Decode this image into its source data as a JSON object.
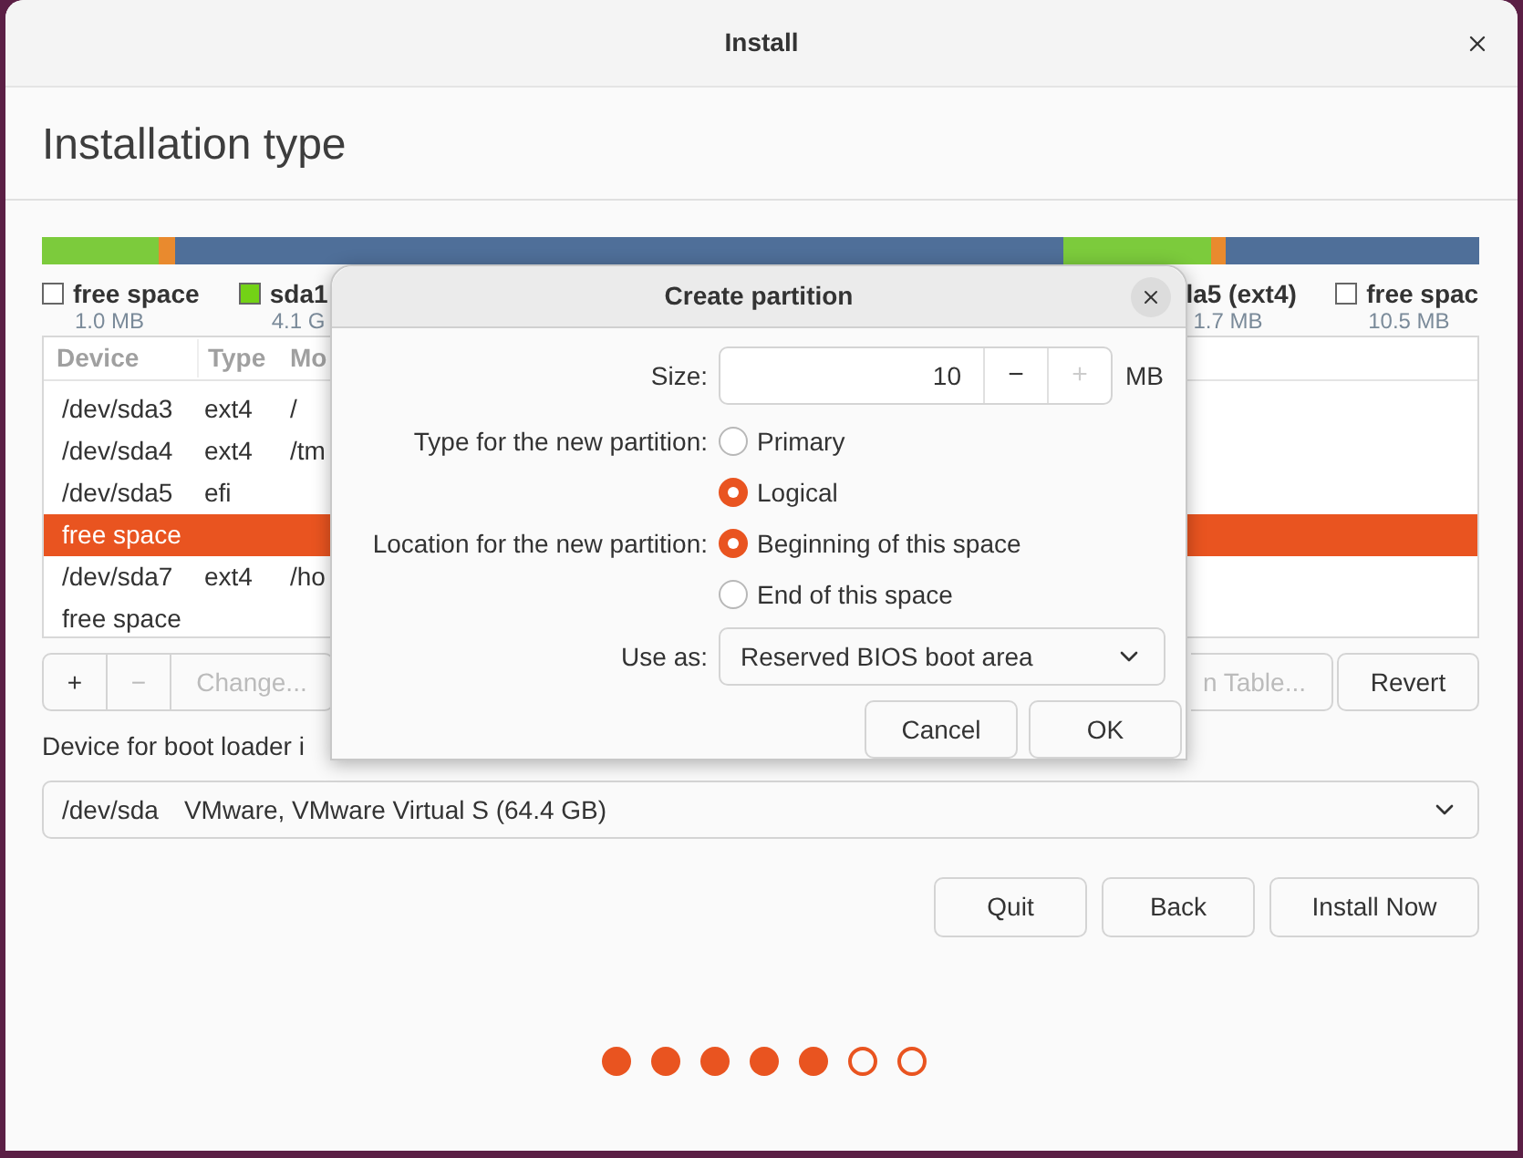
{
  "window": {
    "title": "Install"
  },
  "heading": "Installation type",
  "partition_bar": [
    {
      "color": "#7ccb3c"
    },
    {
      "color": "#e98a2e"
    },
    {
      "color": "#4f6f99"
    },
    {
      "color": "#7ccb3c"
    },
    {
      "color": "#e98a2e"
    },
    {
      "color": "#4f6f99"
    }
  ],
  "legend": [
    {
      "label": "free space",
      "size": "1.0 MB",
      "color": "#ffffff"
    },
    {
      "label": "sda1",
      "size": "4.1 G",
      "color": "#73d216"
    },
    {
      "label": "la5 (ext4)",
      "size": "1.7 MB"
    },
    {
      "label": "free spac",
      "size": "10.5 MB",
      "color": "#ffffff"
    }
  ],
  "table": {
    "columns": [
      "Device",
      "Type",
      "Mo"
    ],
    "rows": [
      {
        "cells": [
          "/dev/sda3",
          "ext4",
          "/"
        ],
        "selected": false
      },
      {
        "cells": [
          "/dev/sda4",
          "ext4",
          "/tm"
        ],
        "selected": false
      },
      {
        "cells": [
          "/dev/sda5",
          "efi",
          ""
        ],
        "selected": false
      },
      {
        "cells": [
          "free space",
          "",
          ""
        ],
        "selected": true
      },
      {
        "cells": [
          "/dev/sda7",
          "ext4",
          "/ho"
        ],
        "selected": false
      },
      {
        "cells": [
          "free space",
          "",
          ""
        ],
        "selected": false
      }
    ]
  },
  "table_buttons": [
    {
      "label": "+",
      "disabled": false
    },
    {
      "label": "−",
      "disabled": true
    },
    {
      "label": "Change...",
      "disabled": true
    }
  ],
  "table_buttons_right": [
    {
      "label": "n Table...",
      "disabled": true
    },
    {
      "label": "Revert",
      "disabled": false
    }
  ],
  "boot_loader": {
    "label": "Device for boot loader i",
    "device": "/dev/sda",
    "description": "VMware, VMware Virtual S (64.4 GB)"
  },
  "buttons": [
    "Quit",
    "Back",
    "Install Now"
  ],
  "progress": [
    {
      "done": true
    },
    {
      "done": true
    },
    {
      "done": true
    },
    {
      "done": true
    },
    {
      "done": true
    },
    {
      "done": false
    },
    {
      "done": false
    }
  ],
  "dialog": {
    "title": "Create partition",
    "size": {
      "label": "Size:",
      "value": "10",
      "minus": "−",
      "plus": "+",
      "plus_disabled": true,
      "unit": "MB"
    },
    "type": {
      "label": "Type for the new partition:",
      "options": [
        {
          "label": "Primary",
          "selected": false
        },
        {
          "label": "Logical",
          "selected": true
        }
      ]
    },
    "location": {
      "label": "Location for the new partition:",
      "options": [
        {
          "label": "Beginning of this space",
          "selected": true
        },
        {
          "label": "End of this space",
          "selected": false
        }
      ]
    },
    "use_as": {
      "label": "Use as:",
      "value": "Reserved BIOS boot area"
    },
    "buttons": [
      "Cancel",
      "OK"
    ]
  }
}
